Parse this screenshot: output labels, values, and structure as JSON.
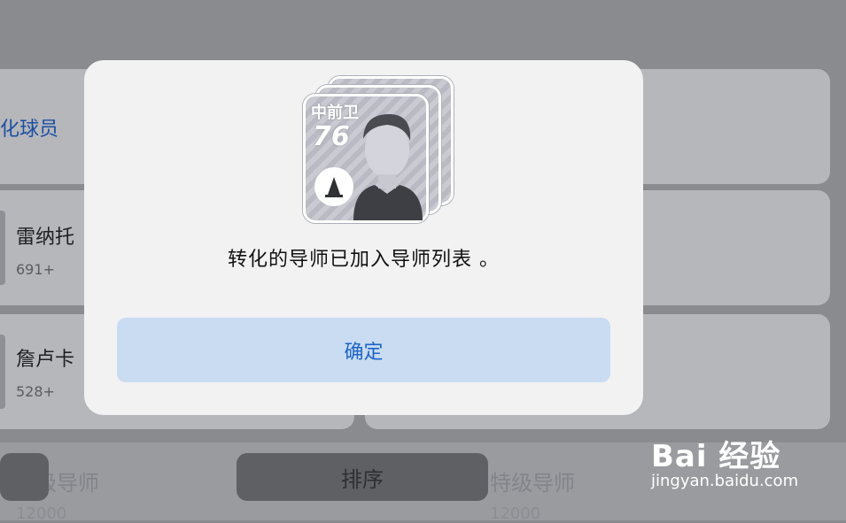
{
  "background": {
    "header_link": "化球员",
    "list_items": [
      {
        "name": "雷纳托",
        "count": "691+"
      },
      {
        "name": "詹卢卡",
        "count": "528+"
      }
    ],
    "bottom_left_faded": "级导师",
    "bottom_left_num": "12000",
    "bottom_right_faded": "特级导师",
    "bottom_right_num": "12000",
    "sort_label": "排序"
  },
  "dialog": {
    "card": {
      "position": "中前卫",
      "rating": "76"
    },
    "message": "转化的导师已加入导师列表 。",
    "confirm_label": "确定"
  },
  "watermark": {
    "top": "Bai 经验",
    "sub": "jingyan.baidu.com"
  }
}
